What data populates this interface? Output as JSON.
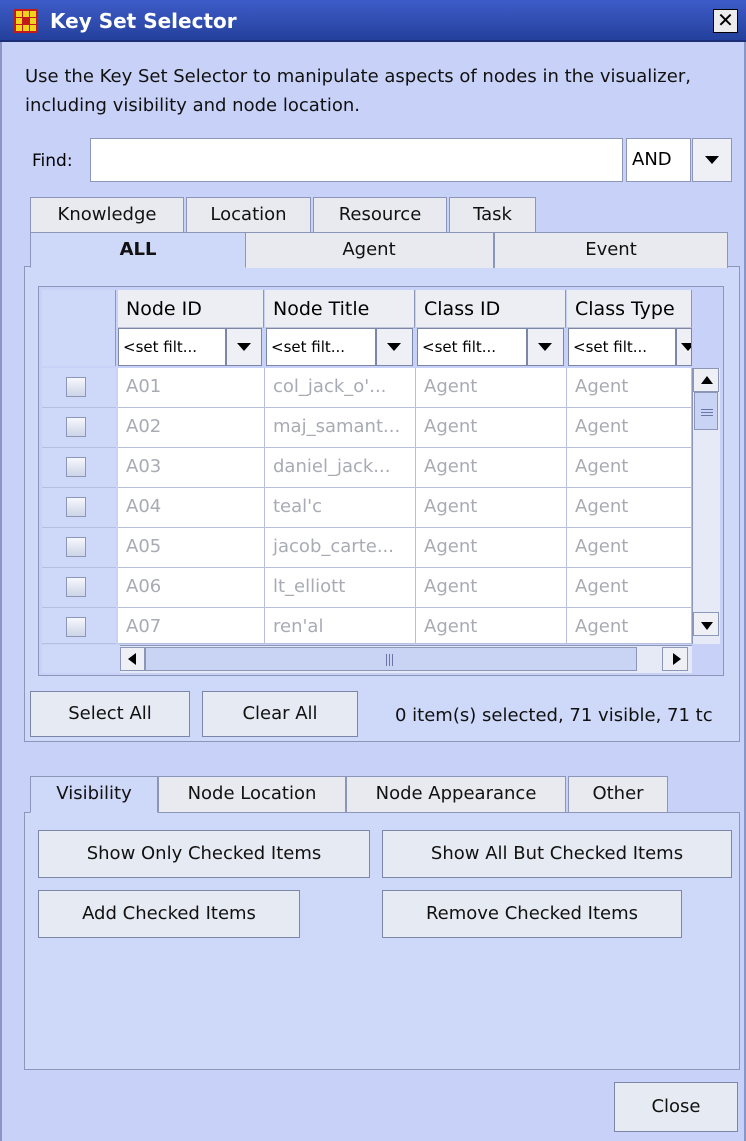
{
  "window": {
    "title": "Key Set Selector",
    "close_glyph": "✕",
    "description": "Use the Key Set Selector to manipulate aspects of nodes in the visualizer, including visibility and node location."
  },
  "find": {
    "label": "Find:",
    "value": "",
    "operator": "AND"
  },
  "node_class_tabs": {
    "back_row": [
      "Knowledge",
      "Location",
      "Resource",
      "Task"
    ],
    "front_row": [
      "ALL",
      "Agent",
      "Event"
    ],
    "selected": "ALL"
  },
  "table": {
    "columns": [
      "Node ID",
      "Node Title",
      "Class ID",
      "Class Type"
    ],
    "filter_placeholder": "<set filt...",
    "rows": [
      {
        "node_id": "A01",
        "node_title": "col_jack_o'...",
        "class_id": "Agent",
        "class_type": "Agent",
        "checked": false
      },
      {
        "node_id": "A02",
        "node_title": "maj_samant...",
        "class_id": "Agent",
        "class_type": "Agent",
        "checked": false
      },
      {
        "node_id": "A03",
        "node_title": "daniel_jack...",
        "class_id": "Agent",
        "class_type": "Agent",
        "checked": false
      },
      {
        "node_id": "A04",
        "node_title": "teal'c",
        "class_id": "Agent",
        "class_type": "Agent",
        "checked": false
      },
      {
        "node_id": "A05",
        "node_title": "jacob_carte...",
        "class_id": "Agent",
        "class_type": "Agent",
        "checked": false
      },
      {
        "node_id": "A06",
        "node_title": "lt_elliott",
        "class_id": "Agent",
        "class_type": "Agent",
        "checked": false
      },
      {
        "node_id": "A07",
        "node_title": "ren'al",
        "class_id": "Agent",
        "class_type": "Agent",
        "checked": false
      }
    ]
  },
  "selection": {
    "select_all_label": "Select All",
    "clear_all_label": "Clear All",
    "status": "0 item(s) selected, 71 visible, 71 tc"
  },
  "action_tabs": {
    "items": [
      "Visibility",
      "Node Location",
      "Node Appearance",
      "Other"
    ],
    "selected": "Visibility"
  },
  "visibility_actions": {
    "show_only_checked": "Show Only Checked Items",
    "show_all_but_checked": "Show All But Checked Items",
    "add_checked": "Add Checked Items",
    "remove_checked": "Remove Checked Items"
  },
  "footer": {
    "close_label": "Close"
  },
  "colors": {
    "title_bar": "#2c48a8",
    "window_bg": "#c8d2f8",
    "disabled_text": "#a9abb4"
  },
  "icons": {
    "app_icon": "ora-grid-icon",
    "dropdown": "chevron-down-icon",
    "scroll": "arrow-icons"
  }
}
